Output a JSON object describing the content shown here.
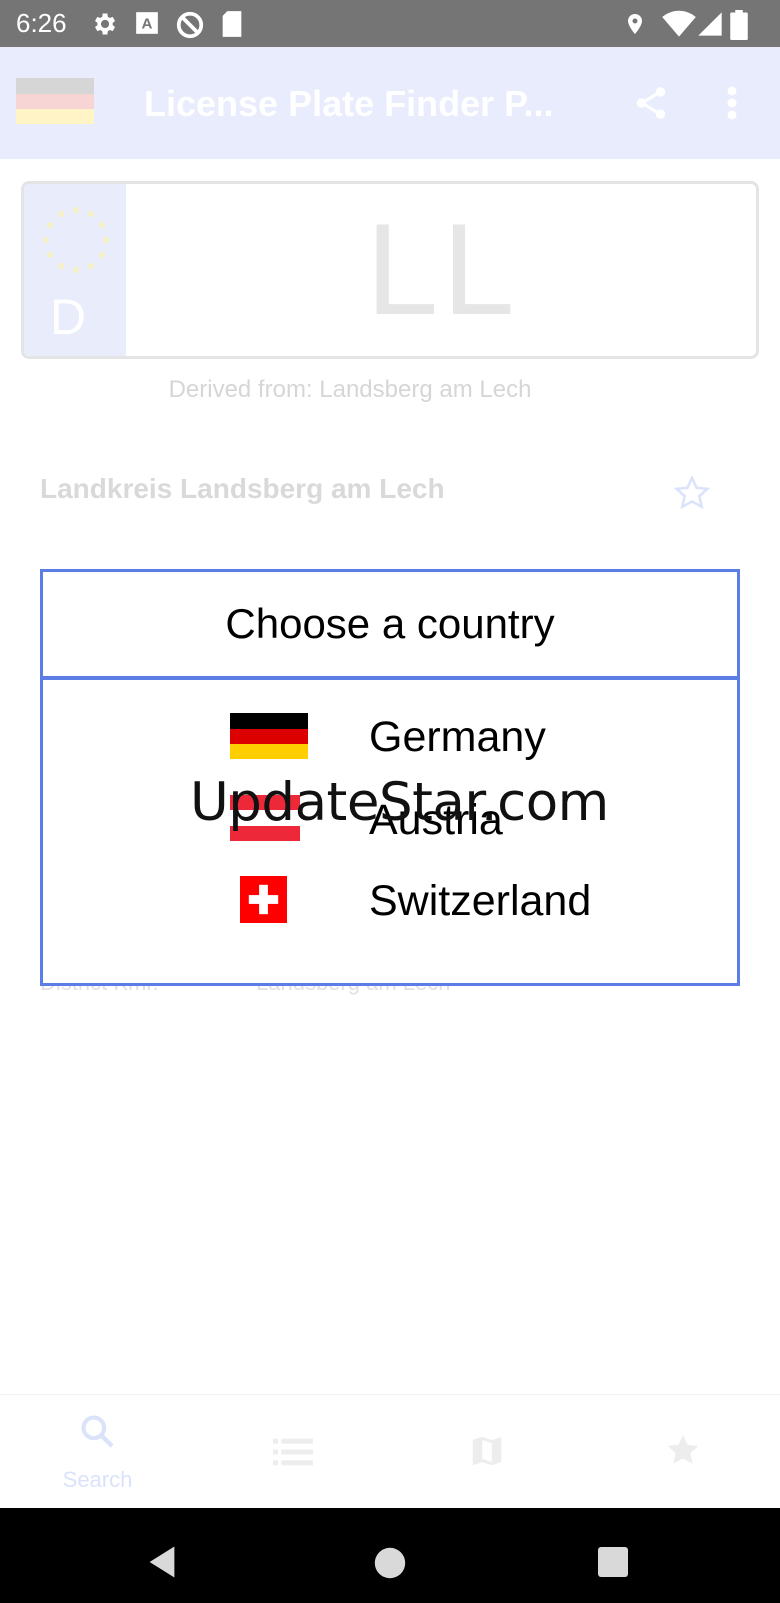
{
  "status_bar": {
    "time": "6:26",
    "icons_left": [
      "gear-icon",
      "a-box-icon",
      "no-sync-icon",
      "sd-card-icon"
    ],
    "icons_right": [
      "location-icon",
      "wifi-icon",
      "signal-icon",
      "battery-icon"
    ]
  },
  "app_bar": {
    "title": "License Plate Finder P...",
    "flag": "germany-flag",
    "actions": [
      "share-icon",
      "more-vert-icon"
    ]
  },
  "plate": {
    "country_letter": "D",
    "code": "LL",
    "derived_from": "Derived from: Landsberg am Lech"
  },
  "result": {
    "district": "Landkreis Landsberg am Lech",
    "row_label": "District Kmr.",
    "row_value": "Landsberg am Lech"
  },
  "dialog": {
    "title": "Choose a country",
    "countries": [
      {
        "name": "Germany",
        "flag": "germany-flag"
      },
      {
        "name": "Austria",
        "flag": "austria-flag"
      },
      {
        "name": "Switzerland",
        "flag": "switzerland-flag"
      }
    ]
  },
  "watermark": "UpdateStar.com",
  "bottom_nav": {
    "items": [
      {
        "label": "Search",
        "icon": "search-icon"
      },
      {
        "label": "",
        "icon": "list-icon"
      },
      {
        "label": "",
        "icon": "map-icon"
      },
      {
        "label": "",
        "icon": "star-icon"
      }
    ]
  },
  "system_nav": [
    "back-icon",
    "home-icon",
    "recents-icon"
  ],
  "colors": {
    "accent": "#5d7de6",
    "status_bar": "#757575",
    "app_bar_dimmed": "#e8ecfd"
  }
}
